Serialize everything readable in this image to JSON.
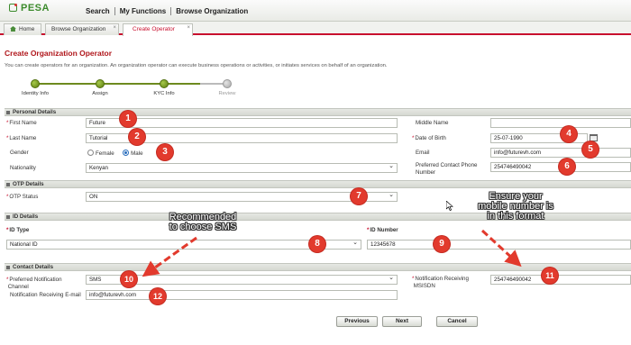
{
  "app": {
    "logo_text_m": "M",
    "logo_text_pesa": "PESA",
    "nav": [
      "Search",
      "My Functions",
      "Browse Organization"
    ]
  },
  "tabs": [
    {
      "label": "Home"
    },
    {
      "label": "Browse Organization",
      "close": "×"
    },
    {
      "label": "Create Operator",
      "close": "×"
    }
  ],
  "page": {
    "title": "Create Organization Operator",
    "description": "You can create operators for an organization. An organization operator can execute business operations or activities, or initiates services on behalf of an organization."
  },
  "steps": [
    {
      "label": "Identity Info",
      "state": "done"
    },
    {
      "label": "Assign",
      "state": "done"
    },
    {
      "label": "KYC Info",
      "state": "done"
    },
    {
      "label": "Review",
      "state": "pending"
    }
  ],
  "sections": {
    "personal": "Personal Details",
    "otp": "OTP Details",
    "id": "ID Details",
    "contact": "Contact Details"
  },
  "personal": {
    "first_name_label": "First Name",
    "first_name_value": "Future",
    "last_name_label": "Last Name",
    "last_name_value": "Tutorial",
    "gender_label": "Gender",
    "gender_female": "Female",
    "gender_male": "Male",
    "gender_selected": "Male",
    "nationality_label": "Nationality",
    "nationality_value": "Kenyan",
    "middle_name_label": "Middle Name",
    "middle_name_value": "",
    "dob_label": "Date of Birth",
    "dob_value": "25-07-1990",
    "email_label": "Email",
    "email_value": "info@futurevh.com",
    "phone_label_1": "Preferred Contact Phone",
    "phone_label_2": "Number",
    "phone_value": "254746490042"
  },
  "otp": {
    "status_label": "OTP Status",
    "status_value": "ON"
  },
  "id": {
    "type_label": "ID Type",
    "type_value": "National ID",
    "number_label": "ID Number",
    "number_value": "12345678"
  },
  "contact": {
    "channel_label_1": "Preferred Notification",
    "channel_label_2": "Channel",
    "channel_value": "SMS",
    "email_label": "Notification Receiving E-mail",
    "email_value": "info@futurevh.com",
    "msisdn_label_1": "Notification Receiving",
    "msisdn_label_2": "MSISDN",
    "msisdn_value": "254746490042"
  },
  "buttons": {
    "previous": "Previous",
    "next": "Next",
    "cancel": "Cancel"
  },
  "annotations": {
    "badges": [
      "1",
      "2",
      "3",
      "4",
      "5",
      "6",
      "7",
      "8",
      "9",
      "10",
      "11",
      "12"
    ],
    "recommend_1": "Recommended",
    "recommend_2": "to choose SMS",
    "ensure_1": "Ensure your",
    "ensure_2": "mobile number is",
    "ensure_3": "in this format"
  },
  "colors": {
    "brand_green": "#39932f",
    "accent_red": "#c8102e",
    "badge_red": "#e23a2d",
    "step_green": "#6d8a1f"
  }
}
